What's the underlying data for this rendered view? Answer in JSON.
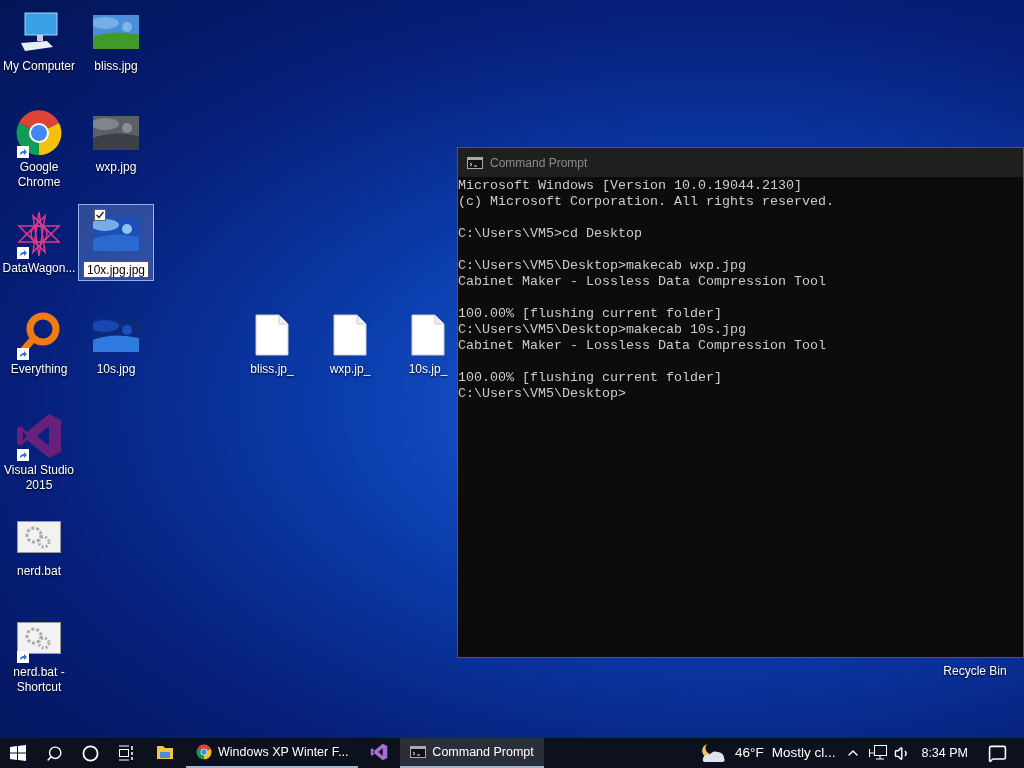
{
  "desktop_icons": [
    {
      "label": "My Computer",
      "kind": "computer",
      "shortcut": false,
      "selected": false,
      "renaming": false
    },
    {
      "label": "bliss.jpg",
      "kind": "picture",
      "shortcut": false,
      "selected": false,
      "renaming": false
    },
    {
      "label": "Google Chrome",
      "kind": "chrome",
      "shortcut": true,
      "selected": false,
      "renaming": false
    },
    {
      "label": "wxp.jpg",
      "kind": "picture",
      "shortcut": false,
      "selected": false,
      "renaming": false
    },
    {
      "label": "DataWagon...",
      "kind": "star",
      "shortcut": true,
      "selected": false,
      "renaming": false
    },
    {
      "label": "10x.jpg.jpg",
      "kind": "picture",
      "shortcut": false,
      "selected": true,
      "renaming": true
    },
    {
      "label": "Everything",
      "kind": "magnifier",
      "shortcut": true,
      "selected": false,
      "renaming": false
    },
    {
      "label": "10s.jpg",
      "kind": "picture",
      "shortcut": false,
      "selected": false,
      "renaming": false
    },
    {
      "label": "bliss.jp_",
      "kind": "file",
      "shortcut": false,
      "selected": false,
      "renaming": false
    },
    {
      "label": "wxp.jp_",
      "kind": "file",
      "shortcut": false,
      "selected": false,
      "renaming": false
    },
    {
      "label": "10s.jp_",
      "kind": "file",
      "shortcut": false,
      "selected": false,
      "renaming": false
    },
    {
      "label": "Visual Studio 2015",
      "kind": "visualstudio",
      "shortcut": true,
      "selected": false,
      "renaming": false
    },
    {
      "label": "nerd.bat",
      "kind": "batch",
      "shortcut": false,
      "selected": false,
      "renaming": false
    },
    {
      "label": "nerd.bat - Shortcut",
      "kind": "batch",
      "shortcut": true,
      "selected": false,
      "renaming": false
    }
  ],
  "recycle_bin": {
    "label": "Recycle Bin"
  },
  "console": {
    "title": "Command Prompt",
    "blocks": [
      [
        "Microsoft Windows [Version 10.0.19044.2130]",
        "(c) Microsoft Corporation. All rights reserved."
      ],
      [
        "C:\\Users\\VM5>cd Desktop"
      ],
      [
        "C:\\Users\\VM5\\Desktop>makecab wxp.jpg",
        "Cabinet Maker - Lossless Data Compression Tool"
      ],
      [
        "100.00% [flushing current folder]",
        "C:\\Users\\VM5\\Desktop>makecab 10s.jpg",
        "Cabinet Maker - Lossless Data Compression Tool"
      ],
      [
        "100.00% [flushing current folder]",
        "C:\\Users\\VM5\\Desktop>"
      ]
    ]
  },
  "taskbar": {
    "apps": [
      {
        "kind": "explorer",
        "open": false,
        "selected": false
      },
      {
        "kind": "chrome",
        "label": "Windows XP Winter F...",
        "open": true,
        "selected": false
      },
      {
        "kind": "visualstudio",
        "open": false,
        "selected": false
      },
      {
        "kind": "console",
        "label": "Command Prompt",
        "open": true,
        "selected": true
      }
    ],
    "weather": {
      "temperature": "46°F",
      "condition": "Mostly cl..."
    },
    "clock": "8:34 PM"
  }
}
